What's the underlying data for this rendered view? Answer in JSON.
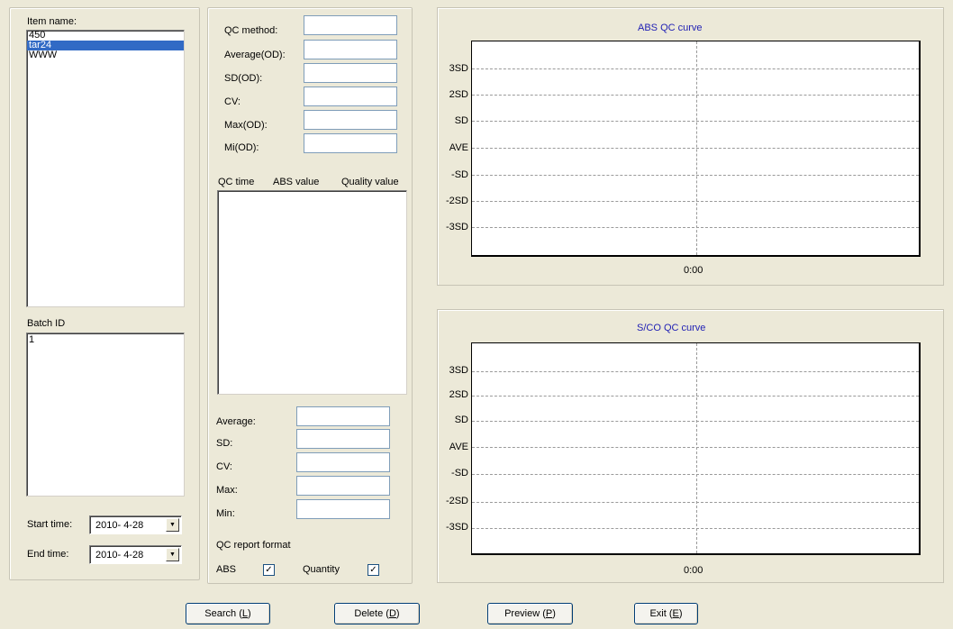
{
  "left": {
    "item_label": "Item name:",
    "items": [
      "450",
      "tar24",
      "WWW"
    ],
    "selected_item_index": 1,
    "batch_label": "Batch ID",
    "batches": [
      "1"
    ],
    "start_label": "Start time:",
    "start_value": "2010- 4-28",
    "end_label": "End time:",
    "end_value": "2010- 4-28"
  },
  "middle": {
    "qc_method_label": "QC method:",
    "average_od_label": "Average(OD):",
    "sd_od_label": "SD(OD):",
    "cv_label": "CV:",
    "max_od_label": "Max(OD):",
    "mi_od_label": "Mi(OD):",
    "qc_method_value": "",
    "average_od_value": "",
    "sd_od_value": "",
    "cv_value": "",
    "max_od_value": "",
    "mi_od_value": "",
    "col_qc_time": "QC time",
    "col_abs_value": "ABS value",
    "col_quality_value": "Quality value",
    "average_label": "Average:",
    "sd_label": "SD:",
    "cv2_label": "CV:",
    "max_label": "Max:",
    "min_label": "Min:",
    "report_format_label": "QC report format",
    "abs_label": "ABS",
    "abs_checked": true,
    "quantity_label": "Quantity",
    "quantity_checked": true
  },
  "charts": {
    "abs": {
      "title": "ABS QC curve",
      "y_ticks": [
        "3SD",
        "2SD",
        "SD",
        "AVE",
        "-SD",
        "-2SD",
        "-3SD"
      ],
      "x_tick": "0:00"
    },
    "sco": {
      "title": "S/CO QC curve",
      "y_ticks": [
        "3SD",
        "2SD",
        "SD",
        "AVE",
        "-SD",
        "-2SD",
        "-3SD"
      ],
      "x_tick": "0:00"
    }
  },
  "buttons": {
    "search": "Search",
    "search_key": "L",
    "delete": "Delete",
    "delete_key": "D",
    "preview": "Preview",
    "preview_key": "P",
    "exit": "Exit",
    "exit_key": "E"
  }
}
